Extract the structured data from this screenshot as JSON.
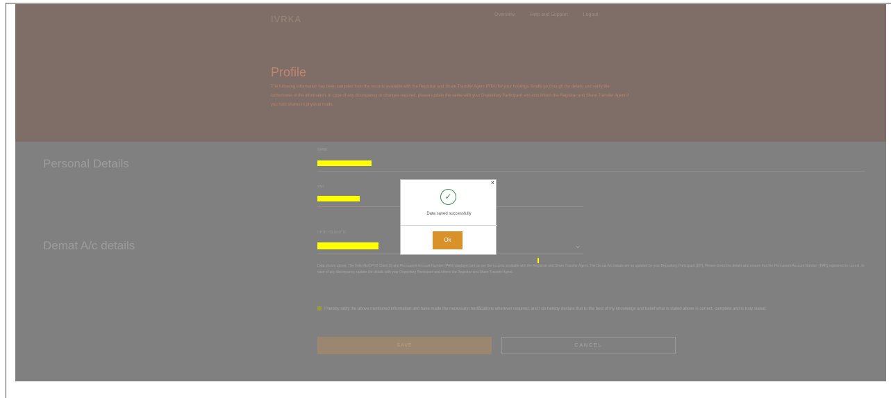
{
  "brand": "IVRKA",
  "nav": {
    "items": [
      "Overview",
      "Help and Support",
      "Logout"
    ]
  },
  "hero": {
    "title": "Profile",
    "text": "The following information has been compiled from the records available with the Registrar and Share Transfer Agent (RTA) for your holdings. Kindly go through the details and verify the correctness of the information. In case of any discrepancy or changes required, please update the same with your Depository Participant and also inform the Registrar and Share Transfer Agent if you hold shares in physical mode."
  },
  "sections": {
    "personal_details": "Personal Details",
    "demat_details": "Demat A/c details"
  },
  "fields": {
    "name_label": "NAME",
    "pan_label": "PAN",
    "dp_label": "DP ID / CLIENT ID"
  },
  "note": "Data shown above: The Folio No/DP ID Client ID and Permanent Account Number (PAN) displayed are as per the records available with the Registrar and Share Transfer Agent. The Demat A/c details are as updated by your Depository Participant (DP). Please check the details and ensure that the Permanent Account Number (PAN) registered is correct. In case of any discrepancy, update the details with your Depository Participant and inform the Registrar and Share Transfer Agent.",
  "declaration": "I hereby ratify the above mentioned information and have made the necessary modifications wherever required, and I do hereby declare that to the best of my knowledge and belief what is stated above is correct, complete and is truly stated.",
  "buttons": {
    "save": "SAVE",
    "cancel": "CANCEL"
  },
  "modal": {
    "message": "Data saved successfully",
    "ok": "Ok",
    "close": "×"
  },
  "colors": {
    "hero_bg": "#7f6e67",
    "overlay_bg": "#808080",
    "ok_button": "#d9922a",
    "success_green": "#3a8a4a",
    "redaction": "#ffff00"
  }
}
